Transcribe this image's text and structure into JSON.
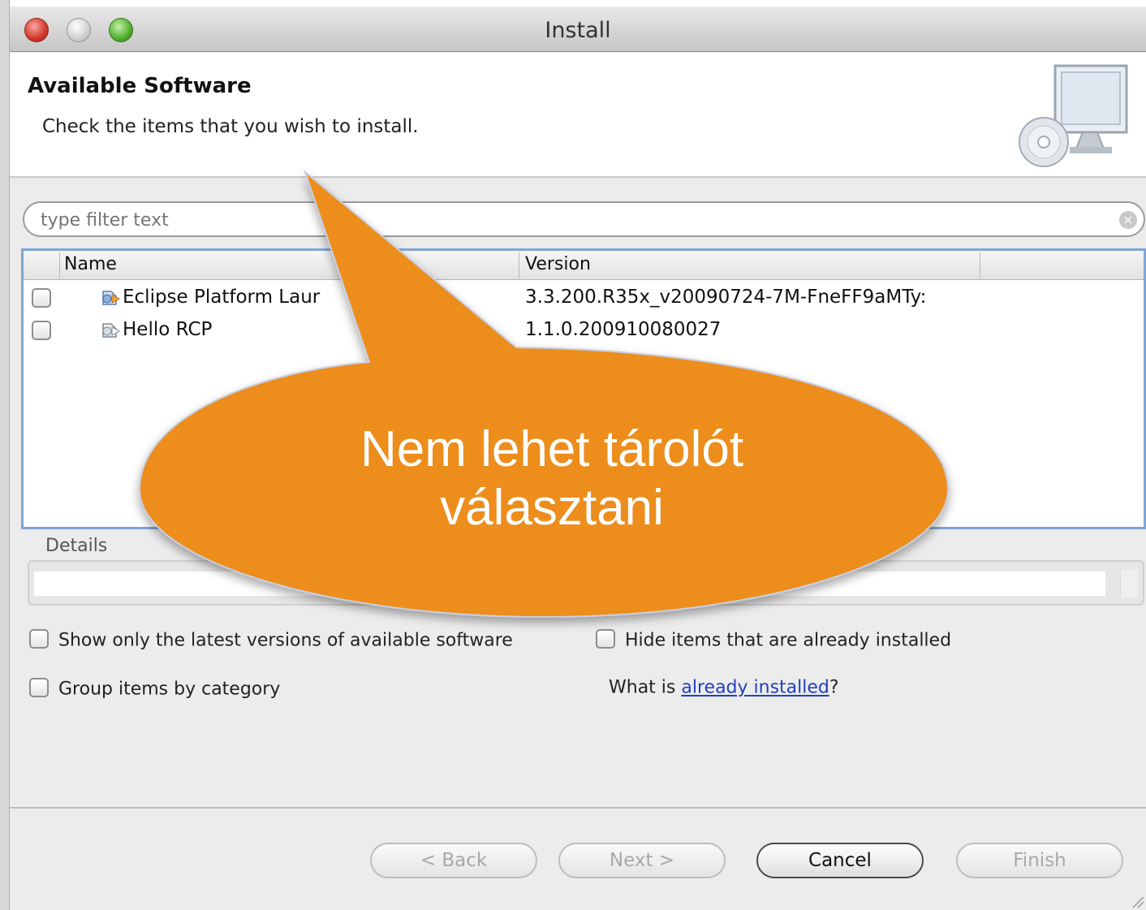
{
  "window": {
    "title": "Install"
  },
  "header": {
    "title": "Available Software",
    "description": "Check the items that you wish to install."
  },
  "filter": {
    "placeholder": "type filter text"
  },
  "table": {
    "columns": [
      "Name",
      "Version"
    ],
    "rows": [
      {
        "name": "Eclipse Platform Laur",
        "version": "3.3.200.R35x_v20090724-7M-FneFF9aMTy:",
        "checked": false
      },
      {
        "name": "Hello RCP",
        "version": "1.1.0.200910080027",
        "checked": false
      }
    ]
  },
  "details": {
    "label": "Details"
  },
  "options": {
    "show_latest": "Show only the latest versions of available software",
    "hide_installed": "Hide items that are already installed",
    "group_by_category": "Group items by category",
    "what_is_prefix": "What is ",
    "already_installed_link": "already installed",
    "what_is_suffix": "?"
  },
  "buttons": {
    "back": "< Back",
    "next": "Next >",
    "cancel": "Cancel",
    "finish": "Finish"
  },
  "callout": {
    "line1": "Nem lehet tárolót",
    "line2": "választani",
    "color": "#ec8d1f"
  }
}
